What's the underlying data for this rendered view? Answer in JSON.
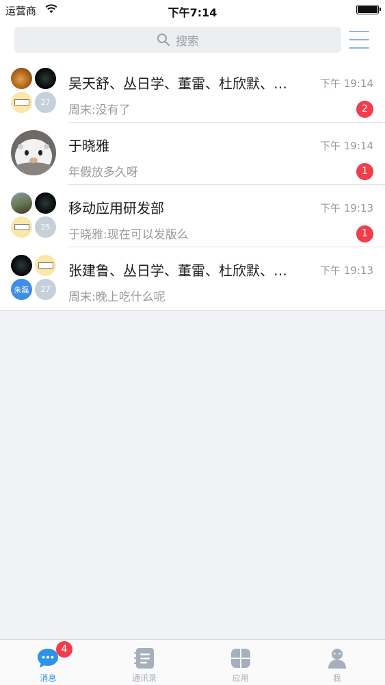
{
  "status_bar": {
    "carrier": "运营商",
    "time": "下午7:14"
  },
  "search": {
    "placeholder": "搜索"
  },
  "conversations": [
    {
      "title": "吴天舒、丛日学、董雷、杜欣默、…",
      "time": "下午 19:14",
      "preview": "周末:没有了",
      "unread": "2",
      "avatar_labels": [
        "",
        "",
        "",
        "27"
      ]
    },
    {
      "title": "于晓雅",
      "time": "下午 19:14",
      "preview": "年假放多久呀",
      "unread": "1"
    },
    {
      "title": "移动应用研发部",
      "time": "下午 19:13",
      "preview": "于晓雅:现在可以发版么",
      "unread": "1",
      "avatar_labels": [
        "",
        "",
        "",
        "25"
      ]
    },
    {
      "title": "张建鲁、丛日学、董雷、杜欣默、…",
      "time": "下午 19:13",
      "preview": "周末:晚上吃什么呢",
      "unread": "",
      "avatar_labels": [
        "",
        "",
        "朱磊",
        "27"
      ]
    }
  ],
  "tabs": [
    {
      "label": "消息",
      "icon": "chat-bubble-icon",
      "active": true,
      "badge": "4"
    },
    {
      "label": "通讯录",
      "icon": "contacts-book-icon",
      "active": false
    },
    {
      "label": "应用",
      "icon": "apps-grid-icon",
      "active": false
    },
    {
      "label": "我",
      "icon": "profile-icon",
      "active": false
    }
  ],
  "colors": {
    "accent": "#2a94e8",
    "badge": "#f23d4c",
    "inactive_tab": "#a6b0bd",
    "background": "#f0f2f5"
  }
}
